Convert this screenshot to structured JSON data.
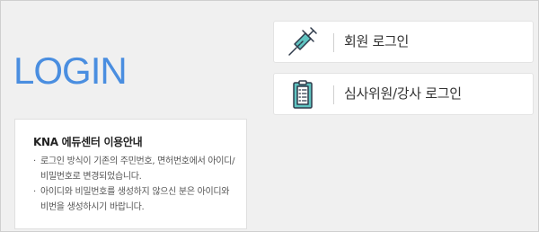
{
  "heading": "LOGIN",
  "notice": {
    "title": "KNA 에듀센터 이용안내",
    "items": [
      "로그인 방식이 기존의 주민번호, 면허번호에서 아이디/비밀번호로 변경되었습니다.",
      "아이디와 비밀번호를 생성하지 않으신 분은 아이디와 비번을 생성하시기 바랍니다."
    ]
  },
  "buttons": {
    "member": {
      "label": "회원 로그인",
      "icon": "syringe-icon"
    },
    "judge": {
      "label": "심사위원/강사 로그인",
      "icon": "clipboard-icon"
    }
  },
  "colors": {
    "heading": "#4a8ee0",
    "icon_teal": "#5fc4c1",
    "icon_outline": "#2e3a4a",
    "background": "#f0f0f0"
  }
}
